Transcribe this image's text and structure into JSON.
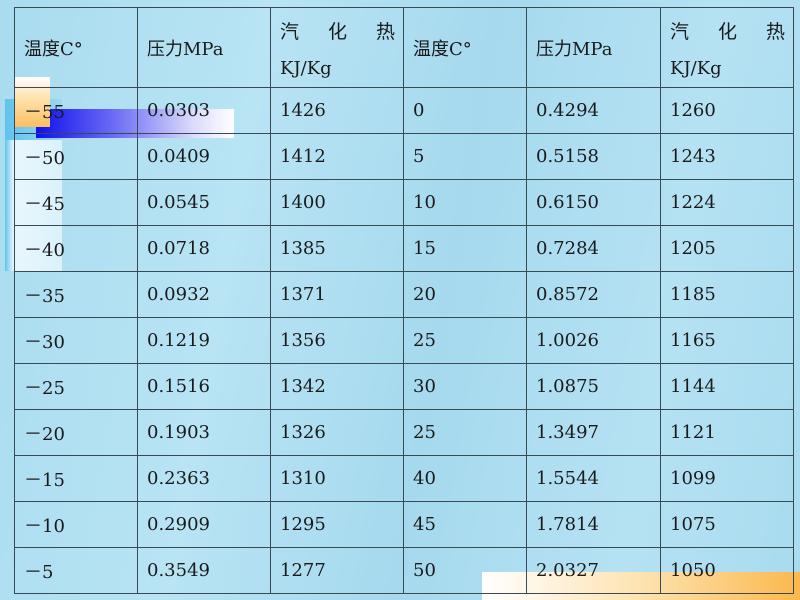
{
  "table": {
    "headers": [
      "温度C°",
      "压力MPa",
      "汽 化 热",
      "温度C°",
      "压力MPa",
      "汽 化 热"
    ],
    "header_heat_chars": [
      "汽",
      "化",
      "热"
    ],
    "header_heat_unit": "KJ/Kg",
    "rows": [
      [
        "－55",
        "0.0303",
        "1426",
        "0",
        "0.4294",
        "1260"
      ],
      [
        "－50",
        "0.0409",
        "1412",
        "5",
        "0.5158",
        "1243"
      ],
      [
        "－45",
        "0.0545",
        "1400",
        "10",
        "0.6150",
        "1224"
      ],
      [
        "－40",
        "0.0718",
        "1385",
        "15",
        "0.7284",
        "1205"
      ],
      [
        "－35",
        "0.0932",
        "1371",
        "20",
        "0.8572",
        "1185"
      ],
      [
        "－30",
        "0.1219",
        "1356",
        "25",
        "1.0026",
        "1165"
      ],
      [
        "－25",
        "0.1516",
        "1342",
        "30",
        "1.0875",
        "1144"
      ],
      [
        "－20",
        "0.1903",
        "1326",
        "25",
        "1.3497",
        "1121"
      ],
      [
        "－15",
        "0.2363",
        "1310",
        "40",
        "1.5544",
        "1099"
      ],
      [
        "－10",
        "0.2909",
        "1295",
        "45",
        "1.7814",
        "1075"
      ],
      [
        "－5",
        "0.3549",
        "1277",
        "50",
        "2.0327",
        "1050"
      ]
    ]
  },
  "colors": {
    "background": "#b0dff2",
    "accent_blue": "#1010ee",
    "accent_orange": "#fbb84d"
  }
}
